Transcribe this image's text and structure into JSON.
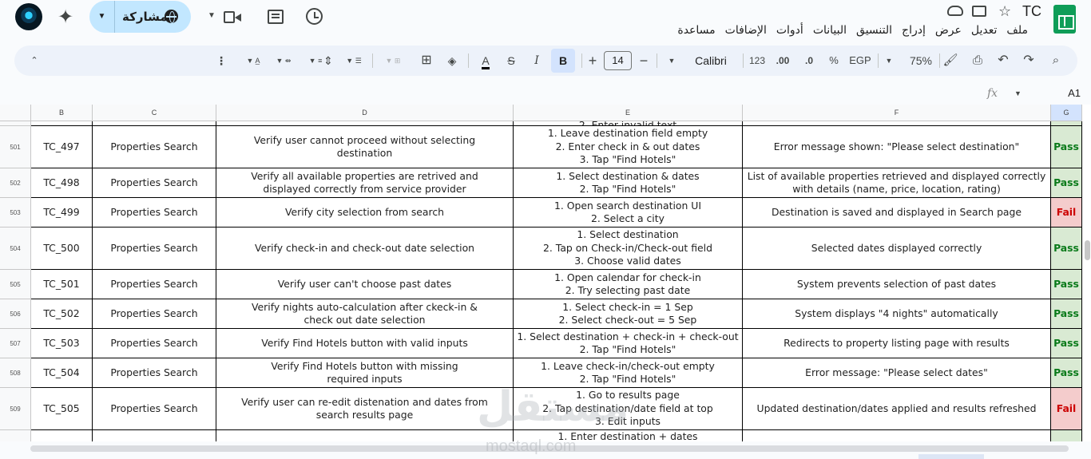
{
  "header": {
    "doc_title": "TC",
    "share_label": "مشاركة",
    "menu": [
      "ملف",
      "تعديل",
      "عرض",
      "إدراج",
      "التنسيق",
      "البيانات",
      "أدوات",
      "الإضافات",
      "مساعدة"
    ]
  },
  "toolbar": {
    "zoom": "75%",
    "currency": "EGP",
    "percent": "%",
    "decimal_less": ".0",
    "decimal_more": ".00",
    "number_format": "123",
    "font": "Calibri",
    "font_size": "14",
    "minus": "−",
    "plus": "+",
    "bold": "B",
    "italic": "I",
    "strike": "S",
    "text_color": "A"
  },
  "formula_bar": {
    "cell_ref": "A1",
    "fx": "fx"
  },
  "columns": [
    "B",
    "C",
    "D",
    "E",
    "F",
    "G"
  ],
  "top_partial_text": "2. Enter invalid text",
  "rows": [
    {
      "num": "501",
      "id": "TC_497",
      "module": "Properties Search",
      "desc": "Verify user cannot proceed without selecting\ndestination",
      "steps": "1. Leave destination field empty\n2. Enter check in & out dates\n3. Tap \"Find Hotels\"",
      "expected": "Error message shown: \"Please select destination\"",
      "status": "Pass"
    },
    {
      "num": "502",
      "id": "TC_498",
      "module": "Properties Search",
      "desc": "Verify all available properties are retrived and\ndisplayed correctly from service provider",
      "steps": "1. Select destination & dates\n2. Tap \"Find Hotels\"",
      "expected": "List of available properties retrieved and displayed correctly\nwith details (name, price, location, rating)",
      "status": "Pass"
    },
    {
      "num": "503",
      "id": "TC_499",
      "module": "Properties Search",
      "desc": "Verify city selection from search",
      "steps": "1. Open search destination UI\n2. Select a city",
      "expected": "Destination is saved and displayed in Search page",
      "status": "Fail"
    },
    {
      "num": "504",
      "id": "TC_500",
      "module": "Properties Search",
      "desc": "Verify check-in and check-out date selection",
      "steps": "1. Select destination\n2. Tap on Check-in/Check-out field\n3. Choose valid dates",
      "expected": "Selected dates displayed correctly",
      "status": "Pass"
    },
    {
      "num": "505",
      "id": "TC_501",
      "module": "Properties Search",
      "desc": "Verify user can't choose past dates",
      "steps": "1. Open calendar for check-in\n2. Try selecting past date",
      "expected": "System prevents selection of past dates",
      "status": "Pass"
    },
    {
      "num": "506",
      "id": "TC_502",
      "module": "Properties Search",
      "desc": "Verify nights auto-calculation after ckeck-in &\ncheck out date selection",
      "steps": "1. Select check-in = 1 Sep\n2. Select check-out = 5 Sep",
      "expected": "System displays \"4 nights\" automatically",
      "status": "Pass"
    },
    {
      "num": "507",
      "id": "TC_503",
      "module": "Properties Search",
      "desc": "Verify Find Hotels button with valid inputs",
      "steps": "1. Select destination + check-in + check-out\n2. Tap \"Find Hotels\"",
      "expected": "Redirects to property listing page with results",
      "status": "Pass"
    },
    {
      "num": "508",
      "id": "TC_504",
      "module": "Properties Search",
      "desc": "Verify Find Hotels button with missing\nrequired inputs",
      "steps": "1. Leave check-in/check-out empty\n2. Tap \"Find Hotels\"",
      "expected": "Error message: \"Please select dates\"",
      "status": "Pass"
    },
    {
      "num": "509",
      "id": "TC_505",
      "module": "Properties Search",
      "desc": "Verify user can re-edit distenation and dates from\nsearch results page",
      "steps": "1. Go to results page\n2. Tap destination/date field at top\n3. Edit inputs",
      "expected": "Updated destination/dates applied and results refreshed",
      "status": "Fail"
    },
    {
      "num": "",
      "id": "",
      "module": "",
      "desc": "",
      "steps": "1. Enter destination + dates",
      "expected": "",
      "status": ""
    }
  ],
  "watermark": {
    "text": "مستقل",
    "sub": "mostaql.com"
  }
}
